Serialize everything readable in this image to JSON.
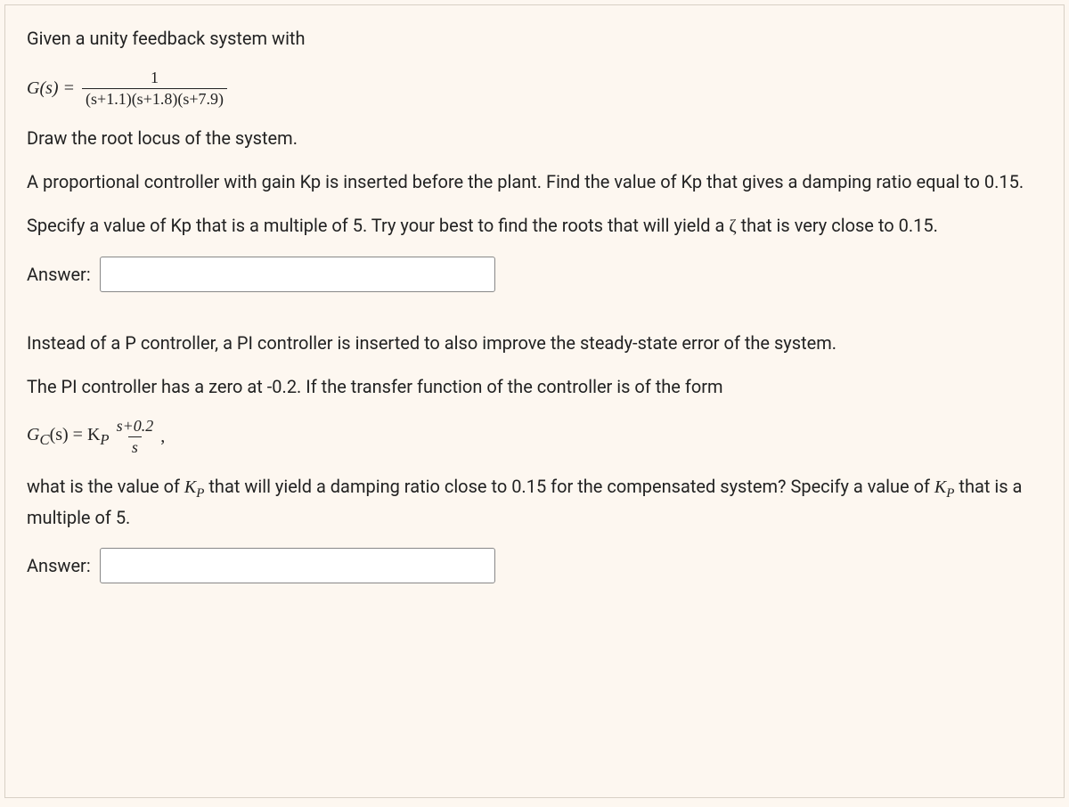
{
  "q1": {
    "intro": "Given a unity feedback system with",
    "lhs": "G(s) = ",
    "num": "1",
    "den": "(s+1.1)(s+1.8)(s+7.9)",
    "task1": "Draw the root locus of the system.",
    "task2": "A proportional controller with gain Kp is inserted before the plant. Find the value of Kp that gives a damping ratio equal to 0.15.",
    "task3a": "Specify a value of Kp that is a multiple of 5. Try your best to find the roots that will yield a ",
    "zeta": "ζ",
    "task3b": " that is very close to 0.15.",
    "answer_label": "Answer:"
  },
  "q2": {
    "intro": "Instead of a P controller, a PI controller is inserted to also improve the steady-state error of the system.",
    "task1": "The PI controller has a zero at -0.2.  If the transfer function of the controller is of the form",
    "lhs_g": "G",
    "lhs_c": "C",
    "lhs_s": "(s) = K",
    "lhs_p": "P",
    "num": "s+0.2",
    "den": "s",
    "comma": ",",
    "task2a": "what is the value of ",
    "kp": "K",
    "kp_sub": "P",
    "task2b": " that will yield a damping ratio close to 0.15 for the compensated system? Specify a value of ",
    "task2c": " that is a multiple of 5.",
    "answer_label": "Answer:"
  }
}
